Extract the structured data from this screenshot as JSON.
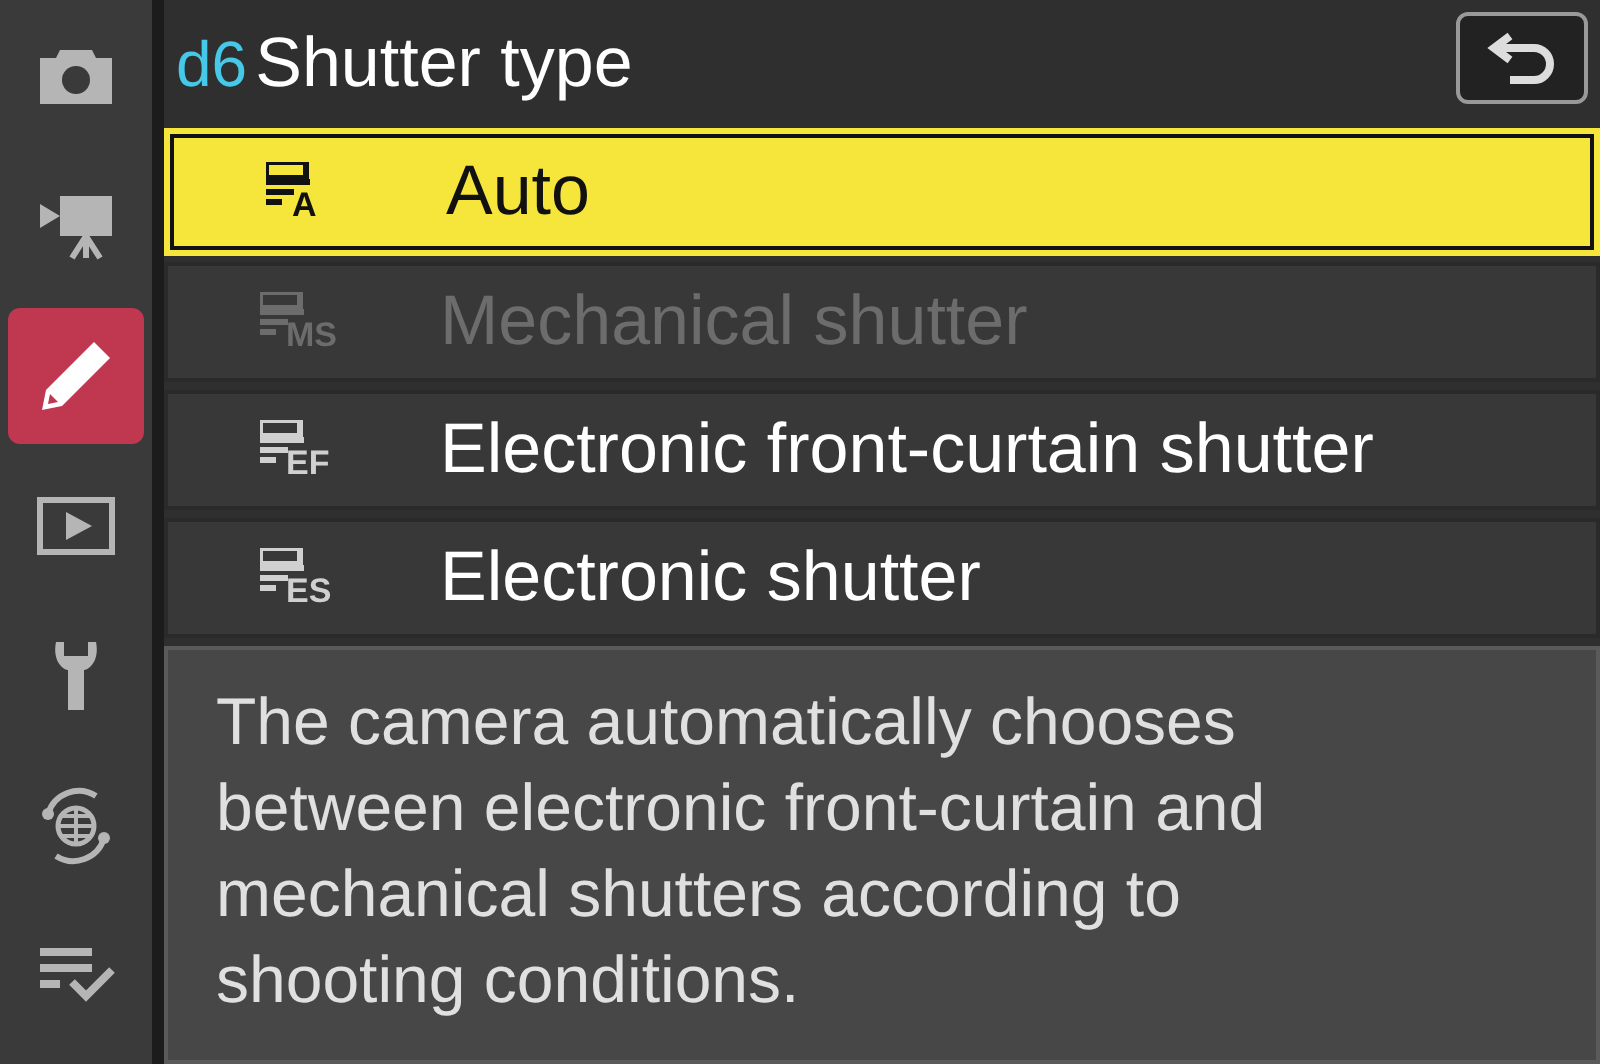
{
  "sidebar": {
    "items": [
      {
        "kind": "camera",
        "selected": false
      },
      {
        "kind": "movie",
        "selected": false
      },
      {
        "kind": "custom",
        "selected": true
      },
      {
        "kind": "playback",
        "selected": false
      },
      {
        "kind": "setup",
        "selected": false
      },
      {
        "kind": "network",
        "selected": false
      },
      {
        "kind": "mymenu",
        "selected": false
      }
    ]
  },
  "header": {
    "code": "d6",
    "title": "Shutter type"
  },
  "options": [
    {
      "icon_label": "A",
      "label": "Auto",
      "selected": true,
      "disabled": false
    },
    {
      "icon_label": "MS",
      "label": "Mechanical shutter",
      "selected": false,
      "disabled": true
    },
    {
      "icon_label": "EF",
      "label": "Electronic front-curtain shutter",
      "selected": false,
      "disabled": false
    },
    {
      "icon_label": "ES",
      "label": "Electronic shutter",
      "selected": false,
      "disabled": false
    }
  ],
  "help": "The camera automatically chooses between electronic front-curtain and mechanical shutters according to shooting conditions."
}
